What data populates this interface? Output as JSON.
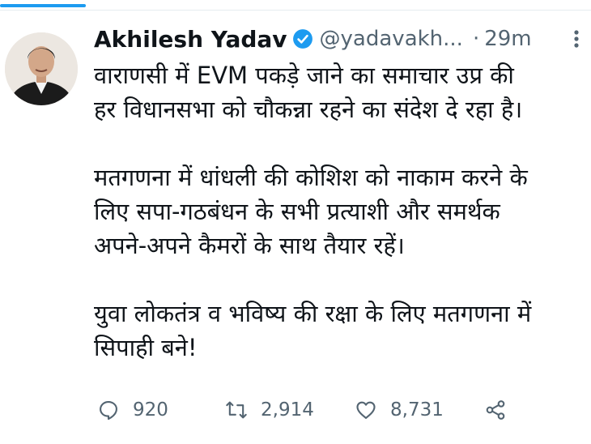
{
  "tweet": {
    "author": {
      "display_name": "Akhilesh Yadav",
      "handle": "@yadavakh...",
      "separator": "·",
      "time": "29m"
    },
    "text": "वाराणसी में EVM पकड़े जाने का समाचार उप्र की\nहर विधानसभा को चौकन्ना रहने का संदेश दे रहा है।\n\nमतगणना में धांधली की कोशिश को नाकाम करने के\nलिए सपा-गठबंधन के सभी प्रत्याशी और समर्थक\nअपने-अपने कैमरों के साथ तैयार रहें।\n\nयुवा लोकतंत्र व भविष्य की रक्षा के लिए मतगणना में\nसिपाही बने!",
    "stats": {
      "replies": "920",
      "retweets": "2,914",
      "likes": "8,731"
    }
  },
  "colors": {
    "accent": "#1d9bf0",
    "muted": "#536471",
    "text": "#0f1419"
  },
  "icons": [
    "verified-badge-icon",
    "more-icon",
    "reply-icon",
    "retweet-icon",
    "like-icon",
    "share-icon"
  ]
}
